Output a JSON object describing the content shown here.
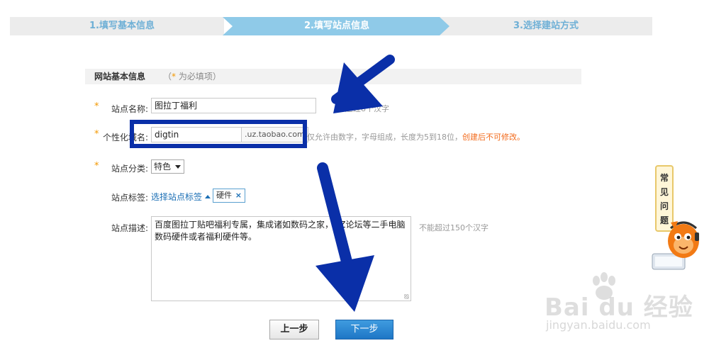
{
  "steps": [
    {
      "label": "1.填写基本信息"
    },
    {
      "label": "2.填写站点信息"
    },
    {
      "label": "3.选择建站方式"
    }
  ],
  "section": {
    "title": "网站基本信息",
    "required_note_star": "*",
    "required_note_text": " 为必填项）",
    "required_note_open": "（"
  },
  "form": {
    "star": "*",
    "site_name": {
      "label": "站点名称:",
      "value": "图拉丁福利",
      "hint": "超过8个汉字"
    },
    "custom_domain": {
      "label": "个性化域名:",
      "value": "digtin",
      "suffix": ".uz.taobao.com",
      "hint": "仅允许由数字，字母组成，长度为5到18位，",
      "hint_warning": "创建后不可修改。"
    },
    "category": {
      "label": "站点分类:",
      "selected": "特色"
    },
    "tags": {
      "label": "站点标签:",
      "select_link": "选择站点标签",
      "chip": "硬件",
      "chip_remove": "×"
    },
    "description": {
      "label": "站点描述:",
      "value": "百度图拉丁贴吧福利专属，集成诸如数码之家，GZ论坛等二手电脑数码硬件或者福利硬件等。",
      "hint": "不能超过150个汉字"
    }
  },
  "buttons": {
    "prev": "上一步",
    "next": "下一步"
  },
  "side_widget": {
    "chars": [
      "常",
      "见",
      "问",
      "题"
    ]
  },
  "watermark": {
    "main": "Bai  du 经验",
    "sub": "jingyan.baidu.com"
  },
  "colors": {
    "accent_blue": "#1e76c5",
    "step_active": "#8fcae8",
    "required_orange": "#f39800",
    "warning_orange": "#f26a1b",
    "annotation_blue": "#0a2fa8"
  }
}
